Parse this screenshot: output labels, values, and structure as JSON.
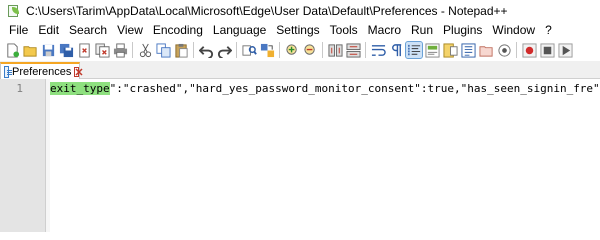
{
  "window": {
    "title": "C:\\Users\\Tarim\\AppData\\Local\\Microsoft\\Edge\\User Data\\Default\\Preferences - Notepad++",
    "app_icon": "notepad-plus-plus-icon"
  },
  "menu": {
    "items": [
      "File",
      "Edit",
      "Search",
      "View",
      "Encoding",
      "Language",
      "Settings",
      "Tools",
      "Macro",
      "Run",
      "Plugins",
      "Window",
      "?"
    ]
  },
  "toolbar": {
    "icons": [
      "new-file-icon",
      "open-file-icon",
      "save-icon",
      "save-all-icon",
      "close-icon",
      "close-all-icon",
      "print-icon",
      "cut-icon",
      "copy-icon",
      "paste-icon",
      "undo-icon",
      "redo-icon",
      "find-icon",
      "replace-icon",
      "zoom-in-icon",
      "zoom-out-icon",
      "sync-vertical-icon",
      "sync-horizontal-icon",
      "word-wrap-icon",
      "show-all-chars-icon",
      "indent-guide-icon",
      "user-language-icon",
      "document-map-icon",
      "function-list-icon",
      "folder-as-workspace-icon",
      "monitoring-icon",
      "record-macro-icon",
      "stop-recording-icon",
      "playback-macro-icon"
    ],
    "active_icon": "indent-guide-icon"
  },
  "tabs": [
    {
      "label": "Preferences",
      "icon": "document-icon",
      "close_icon": "close-tab-icon"
    }
  ],
  "editor": {
    "line_number": "1",
    "selected_text": "exit_type",
    "rest_text": "\":\"crashed\",\"hard_yes_password_monitor_consent\":true,\"has_seen_signin_fre\":tr",
    "highlight_color": "#8ee07f"
  }
}
